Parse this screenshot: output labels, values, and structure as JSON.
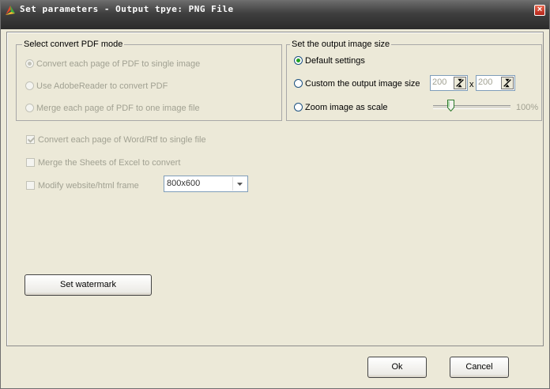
{
  "window": {
    "title": "Set parameters - Output tpye: PNG File",
    "close_label": "×"
  },
  "pdf_mode": {
    "legend": "Select convert PDF mode",
    "options": [
      {
        "label": "Convert each page of PDF to single image",
        "selected": true,
        "enabled": false
      },
      {
        "label": "Use AdobeReader to convert PDF",
        "selected": false,
        "enabled": false
      },
      {
        "label": "Merge each page of PDF to one image file",
        "selected": false,
        "enabled": false
      }
    ]
  },
  "output_size": {
    "legend": "Set the output image size",
    "default_label": "Default settings",
    "custom_label": "Custom the output image size",
    "width_value": "200",
    "x_sep": "x",
    "height_value": "200",
    "zoom_label": "Zoom image as scale",
    "zoom_value": "100%",
    "zoom_fraction": 0.2,
    "selected": "default"
  },
  "options": {
    "word_label": "Convert each page of Word/Rtf to single file",
    "word_checked": true,
    "excel_label": "Merge the Sheets of Excel to convert",
    "excel_checked": false,
    "html_label": "Modify website/html frame",
    "html_checked": false,
    "html_frame_value": "800x600"
  },
  "buttons": {
    "watermark": "Set watermark",
    "ok": "Ok",
    "cancel": "Cancel"
  },
  "colors": {
    "radio_selected": "#21a121",
    "disabled_text": "#a1a192"
  }
}
